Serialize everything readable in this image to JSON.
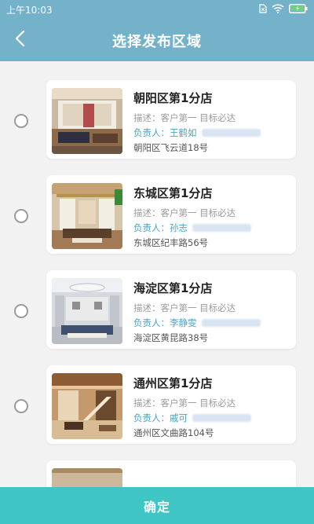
{
  "status_bar": {
    "time": "上午10:03"
  },
  "nav": {
    "title": "选择发布区域"
  },
  "stores": [
    {
      "name": "朝阳区第1分店",
      "desc": "描述：客户第一 目标必达",
      "owner": "负责人：王鹤如",
      "address": "朝阳区飞云道18号",
      "selected": false
    },
    {
      "name": "东城区第1分店",
      "desc": "描述：客户第一 目标必达",
      "owner": "负责人：孙志",
      "address": "东城区纪丰路56号",
      "selected": false
    },
    {
      "name": "海淀区第1分店",
      "desc": "描述：客户第一 目标必达",
      "owner": "负责人：李静雯",
      "address": "海淀区黄昆路38号",
      "selected": false
    },
    {
      "name": "通州区第1分店",
      "desc": "描述：客户第一 目标必达",
      "owner": "负责人：戚可",
      "address": "通州区文曲路104号",
      "selected": false
    }
  ],
  "footer": {
    "confirm_label": "确定"
  },
  "colors": {
    "nav_bg": "#74b2ca",
    "confirm_bg": "#3fc5c3",
    "owner_text": "#4aa3c4"
  },
  "icons": {
    "back": "chevron-left-icon",
    "wifi": "wifi-icon",
    "battery": "battery-icon",
    "sim": "sim-icon"
  }
}
